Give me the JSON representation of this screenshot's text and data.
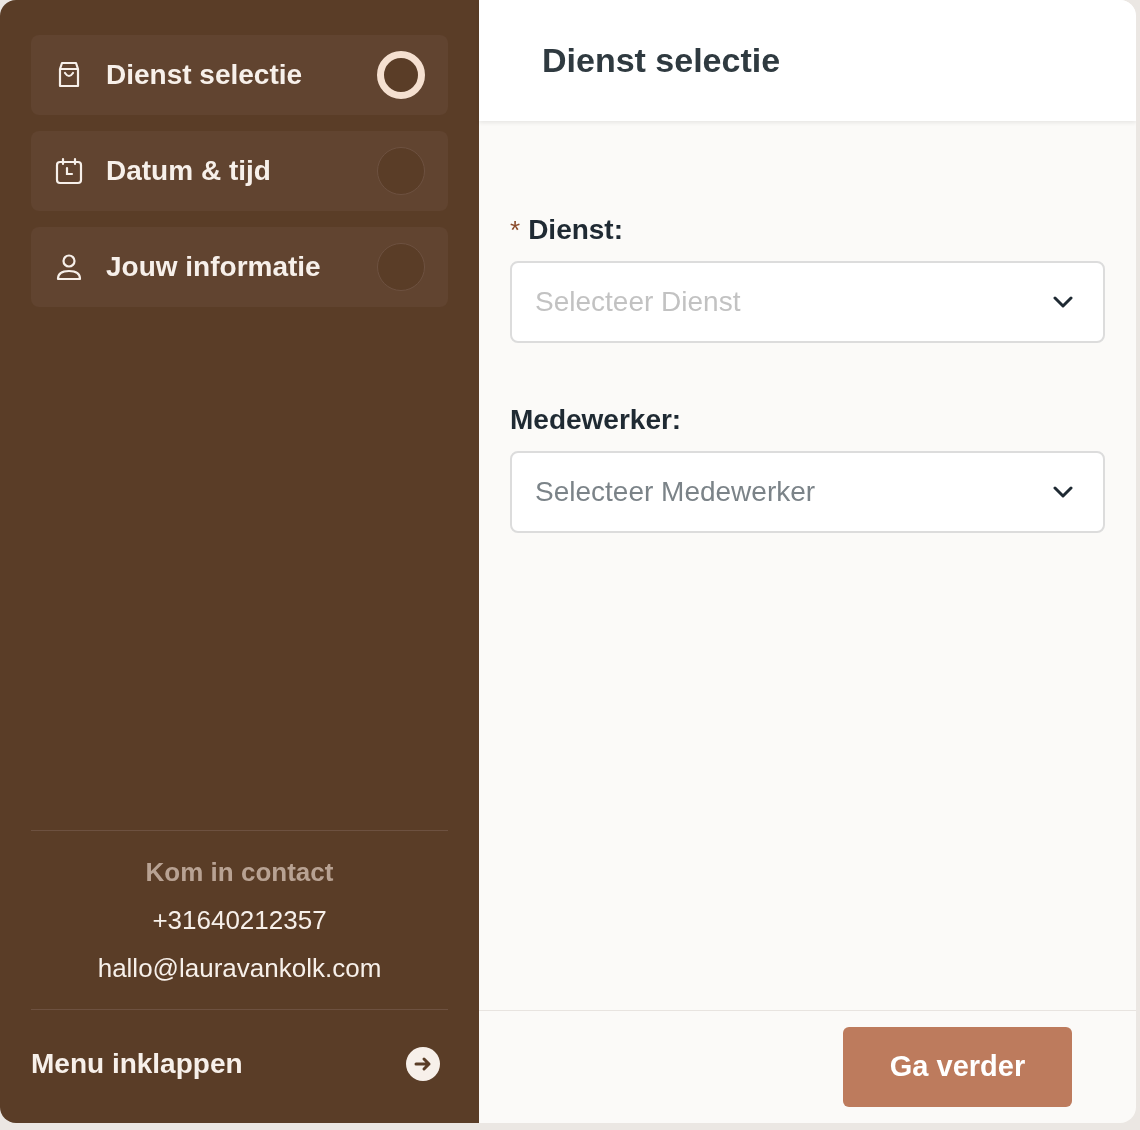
{
  "steps": [
    {
      "label": "Dienst selectie",
      "selected": true
    },
    {
      "label": "Datum & tijd",
      "selected": false
    },
    {
      "label": "Jouw informatie",
      "selected": false
    }
  ],
  "contact": {
    "heading": "Kom in contact",
    "phone": "+31640212357",
    "email": "hallo@lauravankolk.com"
  },
  "collapse": {
    "label": "Menu inklappen"
  },
  "title": "Dienst selectie",
  "fields": [
    {
      "required_mark": "*",
      "label": "Dienst:",
      "placeholder": "Selecteer Dienst"
    },
    {
      "label": "Medewerker:",
      "placeholder": "Selecteer Medewerker"
    }
  ],
  "next_button": "Ga verder"
}
